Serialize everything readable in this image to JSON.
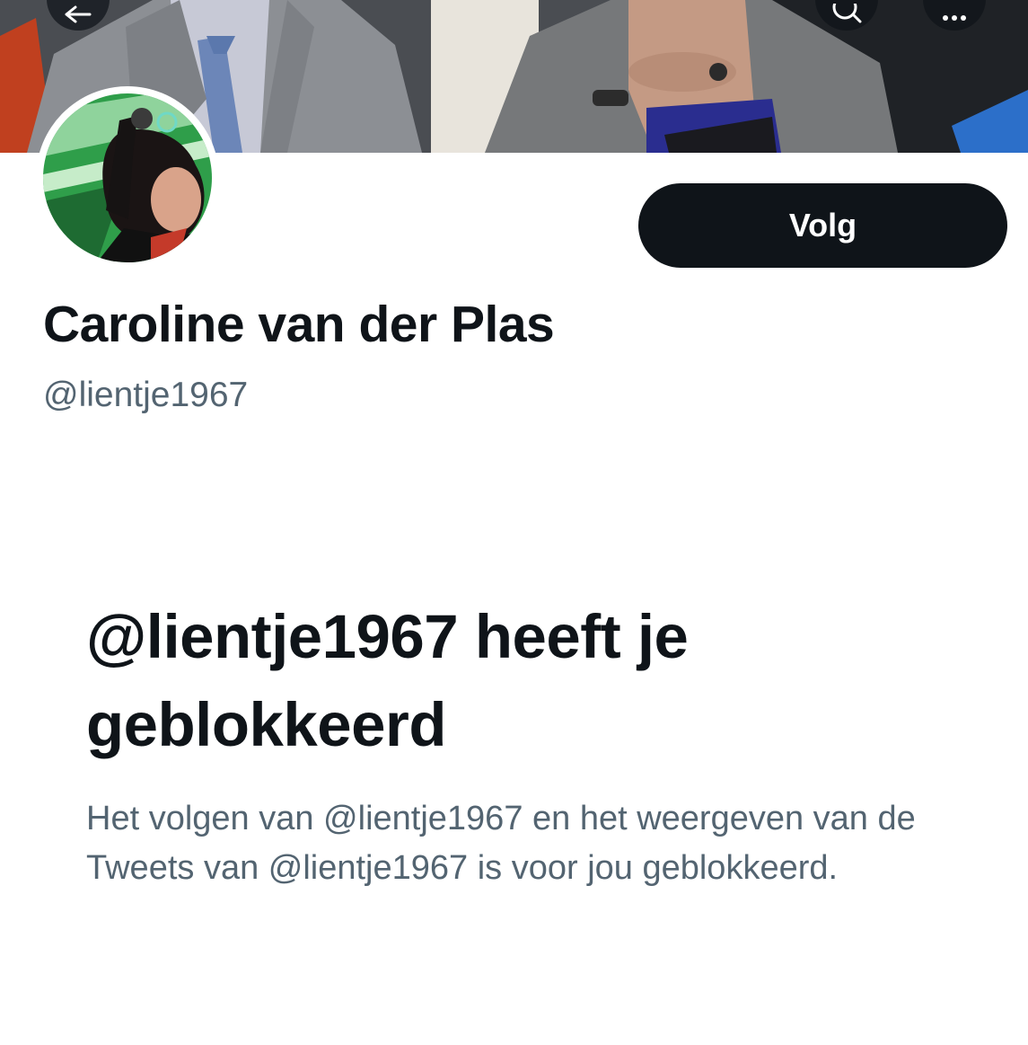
{
  "profile": {
    "display_name": "Caroline van der Plas",
    "handle": "@lientje1967",
    "follow_label": "Volg"
  },
  "blocked": {
    "title": "@lientje1967 heeft je geblokkeerd",
    "body": "Het volgen van @lientje1967 en het weergeven van de Tweets van @lientje1967 is voor jou geblokkeerd."
  },
  "icons": {
    "back": "back-arrow-icon",
    "search": "search-icon",
    "more": "more-icon"
  },
  "colors": {
    "text_primary": "#0f1419",
    "text_secondary": "#536471",
    "button_bg": "#0f1419",
    "button_text": "#ffffff",
    "background": "#ffffff"
  }
}
